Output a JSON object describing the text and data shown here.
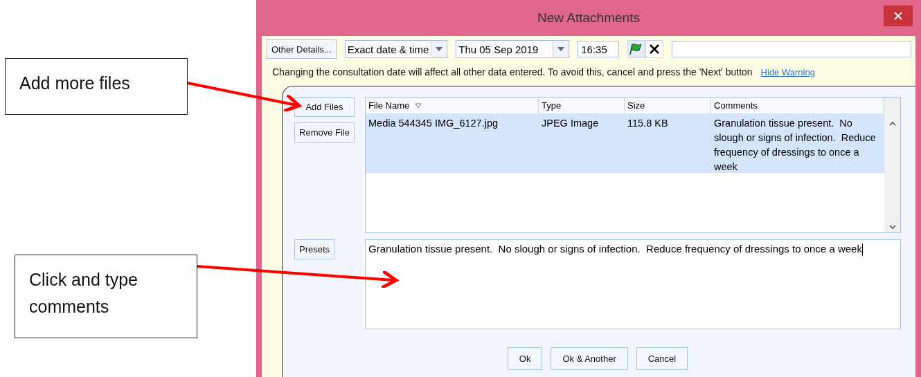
{
  "annotations": [
    {
      "text": "Add more files",
      "kind": "callout"
    },
    {
      "text": "Click and type comments",
      "kind": "callout"
    }
  ],
  "window": {
    "title": "New Attachments"
  },
  "toolbar": {
    "other_details": "Other Details...",
    "date_mode": "Exact date & time",
    "date": "Thu 05 Sep 2019",
    "time": "16:35"
  },
  "warning": {
    "text": "Changing the consultation date will affect all other data entered. To avoid this, cancel and press the 'Next' button",
    "link": "Hide Warning"
  },
  "side_buttons": [
    "Add Files",
    "Remove File"
  ],
  "table": {
    "columns": [
      {
        "label": "File Name",
        "sorted": true
      },
      {
        "label": "Type",
        "sorted": false
      },
      {
        "label": "Size",
        "sorted": false
      },
      {
        "label": "Comments",
        "sorted": false
      }
    ],
    "rows": [
      {
        "selected": true,
        "cells": [
          "Media 544345 IMG_6127.jpg",
          "JPEG Image",
          "115.8 KB",
          "Granulation tissue present.  No slough or signs of infection.  Reduce frequency of dressings to once a week"
        ]
      }
    ]
  },
  "presets": "Presets",
  "comments": {
    "value": "Granulation tissue present.  No slough or signs of infection.  Reduce frequency of dressings to once a week"
  },
  "footer_buttons": [
    "Ok",
    "Ok & Another",
    "Cancel"
  ]
}
